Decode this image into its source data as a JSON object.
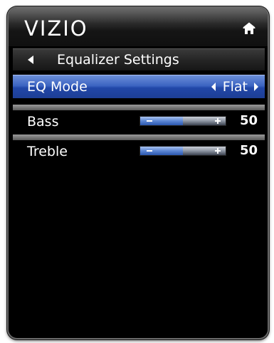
{
  "header": {
    "logo": "VIZIO",
    "home_icon": "home-icon"
  },
  "menu": {
    "title": "Equalizer Settings",
    "back_icon": "left-arrow-icon"
  },
  "eq_mode": {
    "label": "EQ Mode",
    "value": "Flat"
  },
  "bass": {
    "label": "Bass",
    "value": "50",
    "level": 0.5
  },
  "treble": {
    "label": "Treble",
    "value": "50",
    "level": 0.5
  },
  "colors": {
    "highlight": "#3c64c2",
    "background": "#000000",
    "text": "#ffffff"
  }
}
